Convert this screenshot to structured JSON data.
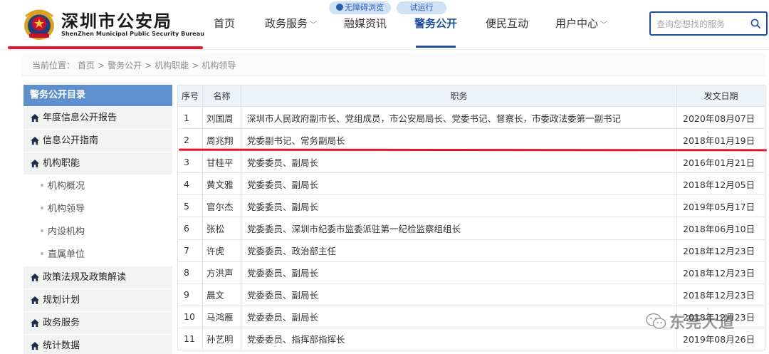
{
  "header": {
    "logo_cn": "深圳市公安局",
    "logo_en": "ShenZhen Municipal Public Security Bureau",
    "nav": [
      {
        "label": "首页",
        "dropdown": false,
        "active": false
      },
      {
        "label": "政务服务",
        "dropdown": true,
        "active": false
      },
      {
        "label": "融媒资讯",
        "dropdown": false,
        "active": false
      },
      {
        "label": "警务公开",
        "dropdown": false,
        "active": true
      },
      {
        "label": "便民互动",
        "dropdown": false,
        "active": false
      },
      {
        "label": "用户中心",
        "dropdown": true,
        "active": false
      }
    ],
    "pill_accessibility": "无障碍浏览",
    "pill_trial": "试运行",
    "search_placeholder": "查询您想找的服务"
  },
  "breadcrumb": {
    "prefix": "当前位置：",
    "items": [
      "首页",
      "警务公开",
      "机构职能",
      "机构领导"
    ],
    "separator": ">"
  },
  "sidebar": {
    "header": "警务公开目录",
    "items": [
      {
        "label": "年度信息公开报告",
        "type": "main"
      },
      {
        "label": "信息公开指南",
        "type": "main"
      },
      {
        "label": "机构职能",
        "type": "main"
      },
      {
        "label": "机构概况",
        "type": "sub"
      },
      {
        "label": "机构领导",
        "type": "sub"
      },
      {
        "label": "内设机构",
        "type": "sub"
      },
      {
        "label": "直属单位",
        "type": "sub"
      },
      {
        "label": "政策法规及政策解读",
        "type": "main"
      },
      {
        "label": "规划计划",
        "type": "main"
      },
      {
        "label": "政务服务",
        "type": "main"
      },
      {
        "label": "统计数据",
        "type": "main"
      }
    ]
  },
  "table": {
    "headers": [
      "序号",
      "名称",
      "职务",
      "发文日期"
    ],
    "rows": [
      [
        "1",
        "刘国周",
        "深圳市人民政府副市长、党组成员，市公安局局长、党委书记、督察长，市委政法委第一副书记",
        "2020年08月07日"
      ],
      [
        "2",
        "周兆翔",
        "党委副书记、常务副局长",
        "2018年01月19日"
      ],
      [
        "3",
        "甘桂平",
        "党委委员、副局长",
        "2016年01月21日"
      ],
      [
        "4",
        "黄文雅",
        "党委委员、副局长",
        "2018年12月05日"
      ],
      [
        "5",
        "官尔杰",
        "党委委员、副局长",
        "2019年05月17日"
      ],
      [
        "6",
        "张松",
        "党委委员、深圳市纪委市监委派驻第一纪检监察组组长",
        "2018年06月10日"
      ],
      [
        "7",
        "许虎",
        "党委委员、政治部主任",
        "2018年12月23日"
      ],
      [
        "8",
        "方洪声",
        "党委委员、副局长",
        "2018年12月23日"
      ],
      [
        "9",
        "晨文",
        "党委委员、副局长",
        "2018年12月23日"
      ],
      [
        "10",
        "马鸿雁",
        "党委委员、副局长",
        "2018年12月23日"
      ],
      [
        "11",
        "孙艺明",
        "党委委员、指挥部指挥长",
        "2019年08月26日"
      ]
    ]
  },
  "watermark": {
    "text": "东莞大道"
  },
  "colors": {
    "primary_blue": "#1f4f9c",
    "sidebar_header": "#5e8fce",
    "highlight_red": "#e8142b",
    "pill_bg": "#cfe0f7"
  }
}
